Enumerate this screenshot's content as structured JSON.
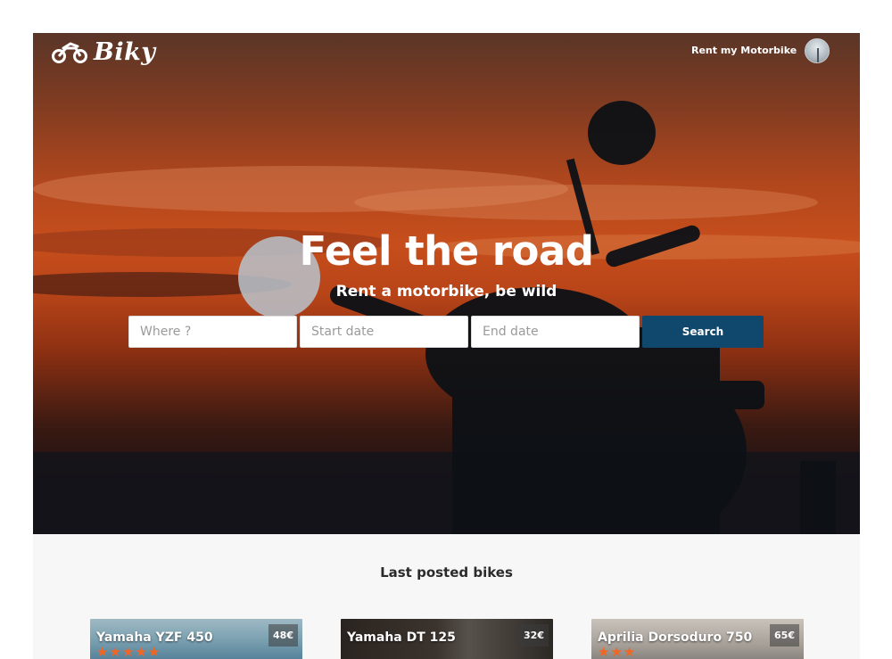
{
  "brand": {
    "name": "Biky",
    "logo_icon": "motorbike-icon"
  },
  "nav": {
    "rent_link": "Rent my Motorbike",
    "avatar_icon": "user-avatar"
  },
  "hero": {
    "title": "Feel the road",
    "subtitle": "Rent a motorbike, be wild"
  },
  "search": {
    "where_placeholder": "Where ?",
    "start_placeholder": "Start date",
    "end_placeholder": "End date",
    "button_label": "Search"
  },
  "listings": {
    "title": "Last posted bikes",
    "bikes": [
      {
        "name": "Yamaha YZF 450",
        "price": "48€",
        "rating": 5
      },
      {
        "name": "Yamaha DT 125",
        "price": "32€",
        "rating": 0
      },
      {
        "name": "Aprilia Dorsoduro 750",
        "price": "65€",
        "rating": 3
      }
    ]
  },
  "colors": {
    "primary": "#10486d",
    "star": "#f26522",
    "hero_sunset": "#c74e1c"
  }
}
